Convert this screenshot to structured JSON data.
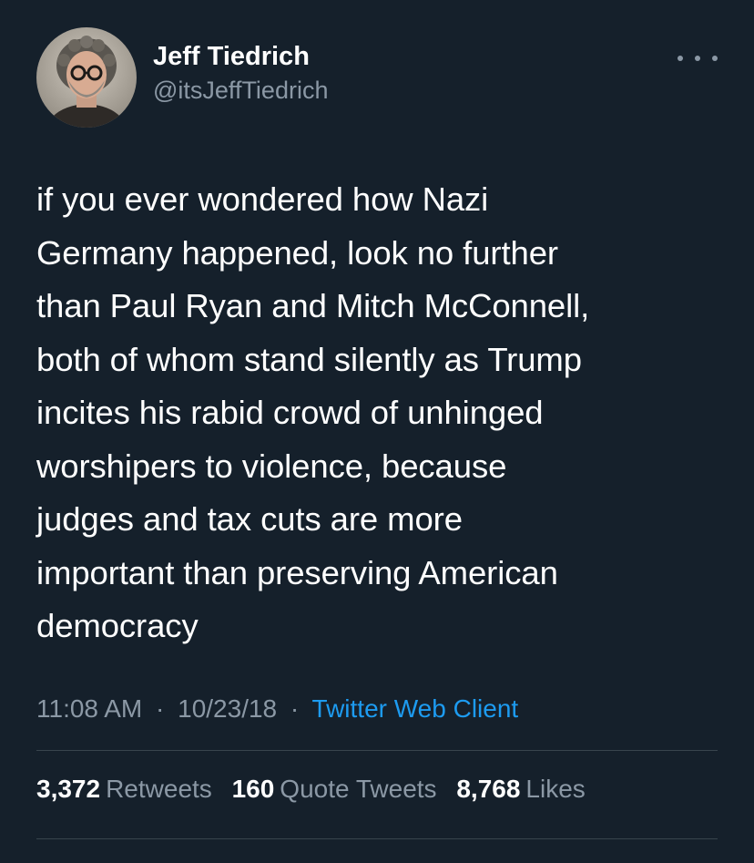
{
  "author": {
    "display_name": "Jeff Tiedrich",
    "handle": "@itsJeffTiedrich"
  },
  "more_icon": "more-horizontal-icon",
  "tweet": {
    "text": "if you ever wondered how Nazi\nGermany happened, look no further\nthan Paul Ryan and Mitch McConnell,\nboth of whom stand silently as Trump\nincites his rabid crowd of unhinged\nworshipers to violence, because\njudges and tax cuts are more\nimportant than preserving American\ndemocracy"
  },
  "meta": {
    "time": "11:08 AM",
    "separator": "·",
    "date": "10/23/18",
    "source": "Twitter Web Client"
  },
  "stats": {
    "retweets_count": "3,372",
    "retweets_label": "Retweets",
    "quotes_count": "160",
    "quotes_label": "Quote Tweets",
    "likes_count": "8,768",
    "likes_label": "Likes"
  },
  "colors": {
    "background": "#15202b",
    "text_primary": "#ffffff",
    "text_secondary": "#8b98a5",
    "link": "#1d9bf0",
    "divider": "#38444d"
  }
}
